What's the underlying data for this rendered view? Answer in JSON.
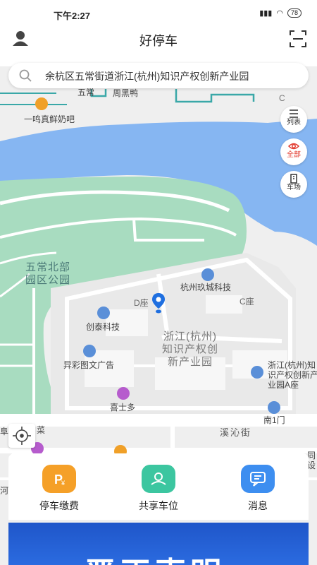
{
  "status": {
    "time": "下午2:27",
    "battery": "78"
  },
  "header": {
    "title": "好停车"
  },
  "search": {
    "text": "余杭区五常街道浙江(杭州)知识产权创新产业园"
  },
  "side_buttons": {
    "list": "列表",
    "all": "全部",
    "parking": "车场"
  },
  "map": {
    "labels": {
      "wuchang": "五常",
      "zhouheiya": "周黑鸭",
      "milk": "一鸣真鲜奶吧",
      "park_line1": "五常北部",
      "park_line2": "园区公园",
      "jiucheng": "杭州玖城科技",
      "d_block": "D座",
      "c_block": "C座",
      "chuangtai": "创泰科技",
      "center_line1": "浙江(杭州)",
      "center_line2": "知识产权创",
      "center_line3": "新产业园",
      "yicai": "异彩图文广告",
      "a_block_line1": "浙江(杭州)知",
      "a_block_line2": "识产权创新产",
      "a_block_line3": "业园A座",
      "xishiduo": "喜士多",
      "south_gate": "南1门",
      "xiqin_street": "溪沁街",
      "cai": "菜",
      "fuzhi": "阜",
      "left_road": "河",
      "right_tong": "同",
      "right_she": "设",
      "c_marker": "C"
    }
  },
  "features": [
    {
      "label": "停车缴费",
      "icon": "parking-fee-icon",
      "color": "#f5a028"
    },
    {
      "label": "共享车位",
      "icon": "shared-spot-icon",
      "color": "#3cc6a0"
    },
    {
      "label": "消息",
      "icon": "message-icon",
      "color": "#3d8ef0"
    }
  ],
  "banner": {
    "text": "严正声明"
  },
  "colors": {
    "water": "#86b6f2",
    "park": "#a8dcc0",
    "road": "#ffffff",
    "block": "#ececec"
  }
}
